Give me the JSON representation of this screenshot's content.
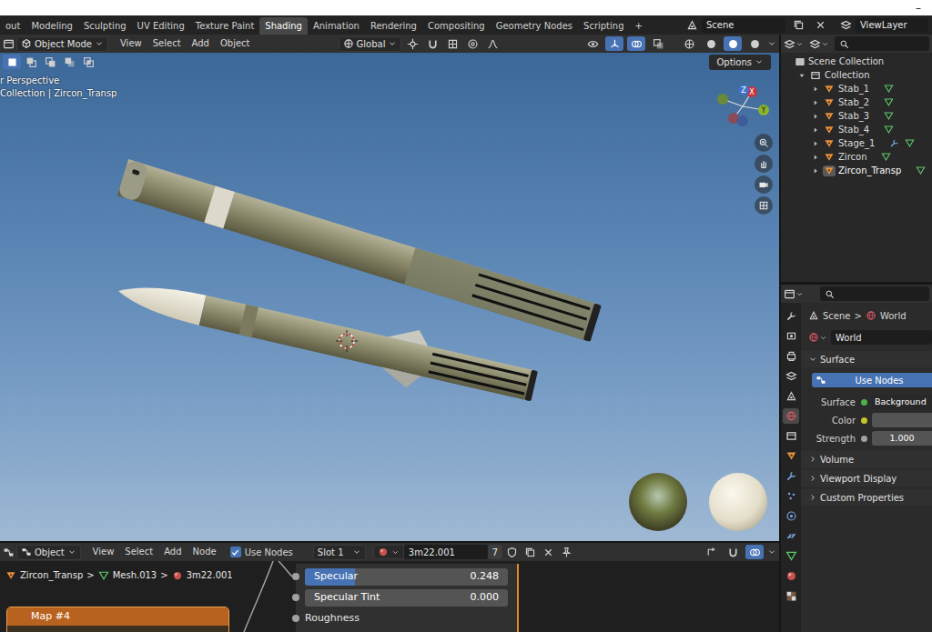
{
  "window": {
    "control": "–"
  },
  "workspaces": {
    "tabs": [
      {
        "label": "out",
        "selected": false
      },
      {
        "label": "Modeling",
        "selected": false
      },
      {
        "label": "Sculpting",
        "selected": false
      },
      {
        "label": "UV Editing",
        "selected": false
      },
      {
        "label": "Texture Paint",
        "selected": false
      },
      {
        "label": "Shading",
        "selected": true
      },
      {
        "label": "Animation",
        "selected": false
      },
      {
        "label": "Rendering",
        "selected": false
      },
      {
        "label": "Compositing",
        "selected": false
      },
      {
        "label": "Geometry Nodes",
        "selected": false
      },
      {
        "label": "Scripting",
        "selected": false
      }
    ],
    "add": "+"
  },
  "scene": {
    "label": "Scene"
  },
  "view_layer": {
    "label": "ViewLayer"
  },
  "viewport": {
    "mode": "Object Mode",
    "menus": [
      "View",
      "Select",
      "Add",
      "Object"
    ],
    "orientation": "Global",
    "toggles": [
      {
        "kind": "visibility",
        "on": false
      },
      {
        "kind": "gizmo",
        "on": true
      },
      {
        "kind": "overlay",
        "on": true
      },
      {
        "kind": "xray",
        "on": false
      }
    ],
    "shading": [
      {
        "kind": "wireframe",
        "selected": false
      },
      {
        "kind": "solid",
        "selected": false
      },
      {
        "kind": "material",
        "selected": true
      },
      {
        "kind": "rendered",
        "selected": false
      }
    ],
    "select_modes": [
      {
        "kind": "new",
        "selected": true
      },
      {
        "kind": "extend",
        "selected": false
      },
      {
        "kind": "subtract",
        "selected": false
      },
      {
        "kind": "invert",
        "selected": false
      },
      {
        "kind": "intersect",
        "selected": false
      }
    ],
    "options": "Options",
    "overlay_text": [
      "r Perspective",
      "Collection | Zircon_Transp"
    ],
    "gizmo": [
      {
        "axis": "Z"
      },
      {
        "axis": "X"
      },
      {
        "axis": "Y"
      }
    ]
  },
  "outliner": {
    "title": "Scene Collection",
    "items": [
      {
        "label": "Collection",
        "depth": 1,
        "kind": "collection",
        "expanded": true,
        "selected": false,
        "children": []
      },
      {
        "label": "Stab_1",
        "depth": 2,
        "kind": "object",
        "expanded": false,
        "selected": false,
        "children": [
          "mesh_data"
        ]
      },
      {
        "label": "Stab_2",
        "depth": 2,
        "kind": "object",
        "expanded": false,
        "selected": false,
        "children": [
          "mesh_data"
        ]
      },
      {
        "label": "Stab_3",
        "depth": 2,
        "kind": "object",
        "expanded": false,
        "selected": false,
        "children": [
          "mesh_data"
        ]
      },
      {
        "label": "Stab_4",
        "depth": 2,
        "kind": "object",
        "expanded": false,
        "selected": false,
        "children": [
          "mesh_data"
        ]
      },
      {
        "label": "Stage_1",
        "depth": 2,
        "kind": "object",
        "expanded": false,
        "selected": false,
        "children": [
          "modifier",
          "mesh_data"
        ]
      },
      {
        "label": "Zircon",
        "depth": 2,
        "kind": "object",
        "expanded": false,
        "selected": false,
        "children": [
          "mesh_data"
        ]
      },
      {
        "label": "Zircon_Transp",
        "depth": 2,
        "kind": "object",
        "expanded": false,
        "selected": true,
        "children": [
          "mesh_data"
        ]
      }
    ]
  },
  "properties": {
    "tabs": [
      {
        "kind": "tool",
        "selected": false
      },
      {
        "kind": "render",
        "selected": false
      },
      {
        "kind": "output",
        "selected": false
      },
      {
        "kind": "view_layer",
        "selected": false
      },
      {
        "kind": "scene",
        "selected": false
      },
      {
        "kind": "world",
        "selected": true
      },
      {
        "kind": "collection",
        "selected": false
      },
      {
        "kind": "object",
        "selected": false
      },
      {
        "kind": "modifier",
        "selected": false
      },
      {
        "kind": "particles",
        "selected": false
      },
      {
        "kind": "physics",
        "selected": false
      },
      {
        "kind": "constraints",
        "selected": false
      },
      {
        "kind": "mesh_data",
        "selected": false
      },
      {
        "kind": "material",
        "selected": false
      },
      {
        "kind": "texture",
        "selected": false
      }
    ],
    "breadcrumb": [
      {
        "label": "Scene",
        "kind": "scene"
      },
      {
        "label": "World",
        "kind": "world"
      }
    ],
    "separator": ">",
    "datablock": "World",
    "panels": [
      {
        "label": "Surface",
        "expanded": true
      },
      {
        "label": "Volume",
        "expanded": false
      },
      {
        "label": "Viewport Display",
        "expanded": false
      },
      {
        "label": "Custom Properties",
        "expanded": false
      }
    ],
    "use_nodes": "Use Nodes",
    "fields": [
      {
        "label": "Surface",
        "value": "Background",
        "color": "#4cb34c"
      },
      {
        "label": "Color",
        "value": "",
        "color": "#c7c729"
      },
      {
        "label": "Strength",
        "value": "1.000",
        "color": "#a1a1a1"
      }
    ]
  },
  "node_editor": {
    "editor": "Object",
    "menus": [
      "View",
      "Select",
      "Add",
      "Node"
    ],
    "use_nodes": {
      "label": "Use Nodes",
      "checked": true
    },
    "slot": "Slot 1",
    "material": "3m22.001",
    "users": "7",
    "toggles": [
      {
        "kind": "parent",
        "on": false
      },
      {
        "kind": "snap",
        "on": false
      },
      {
        "kind": "overlay",
        "on": true
      }
    ],
    "breadcrumb": [
      {
        "label": "Zircon_Transp",
        "kind": "object"
      },
      {
        "label": "Mesh.013",
        "kind": "mesh_data"
      },
      {
        "label": "3m22.001",
        "kind": "material"
      }
    ],
    "separator": ">",
    "frame": {
      "title": "Map #4"
    },
    "sockets": [
      {
        "label": "Specular",
        "value": "0.248",
        "level": 0.248,
        "kind": "slider"
      },
      {
        "label": "Specular Tint",
        "value": "0.000",
        "level": 0,
        "kind": "slider"
      },
      {
        "label": "Roughness",
        "value": "",
        "level": 0,
        "kind": "label"
      }
    ]
  }
}
